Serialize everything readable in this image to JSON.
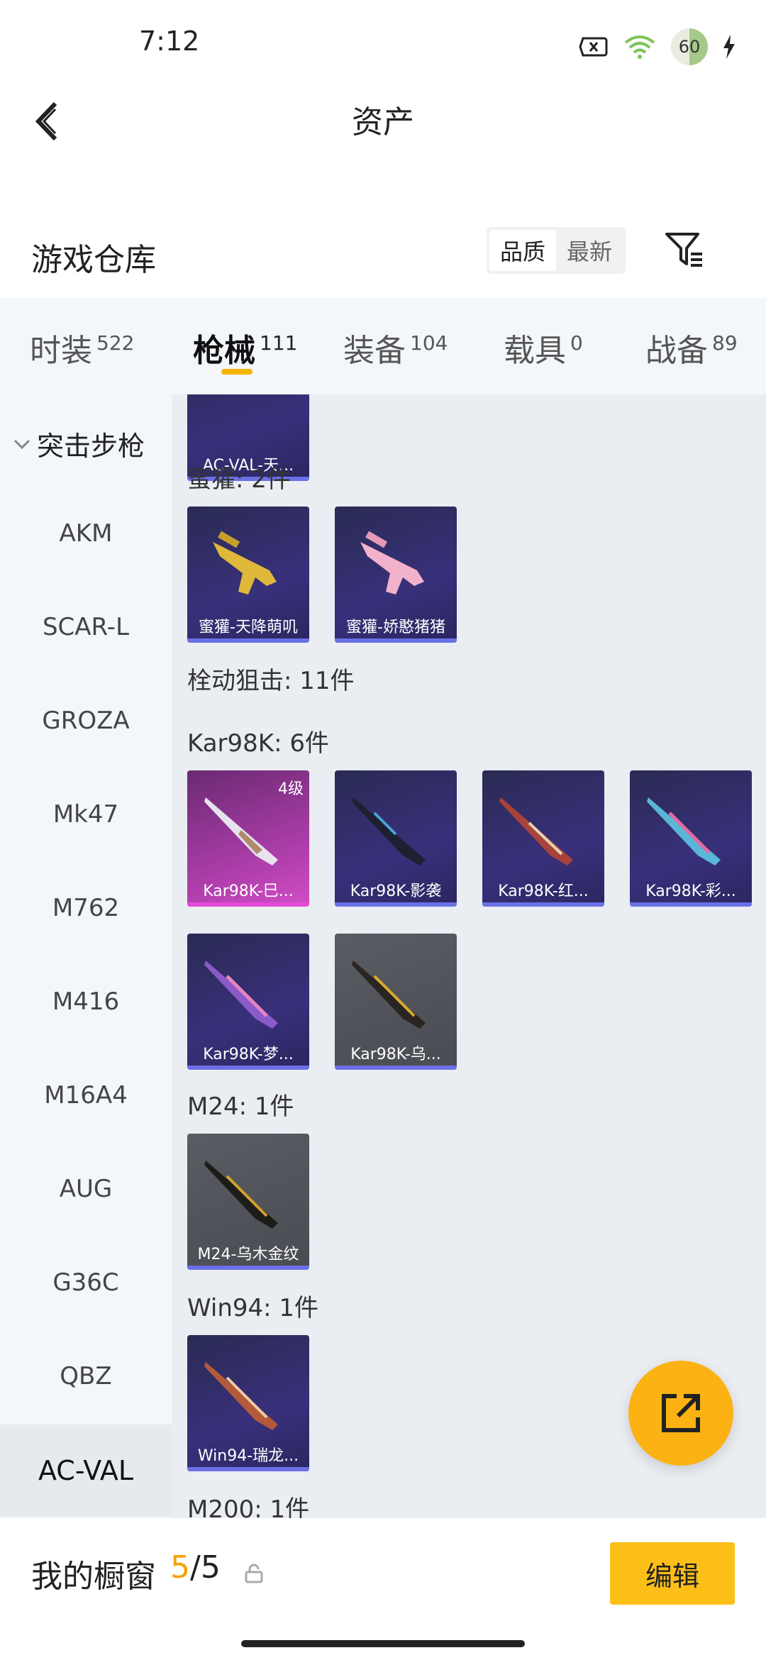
{
  "status": {
    "time": "7:12",
    "battery": "60"
  },
  "header": {
    "title": "资产"
  },
  "section": {
    "title": "游戏仓库",
    "sort_options": [
      "品质",
      "最新"
    ]
  },
  "tabs": [
    {
      "label": "时装",
      "count": "522"
    },
    {
      "label": "枪械",
      "count": "111"
    },
    {
      "label": "装备",
      "count": "104"
    },
    {
      "label": "载具",
      "count": "0"
    },
    {
      "label": "战备",
      "count": "89"
    }
  ],
  "sidebar": {
    "group": "突击步枪",
    "items": [
      "AKM",
      "SCAR-L",
      "GROZA",
      "Mk47",
      "M762",
      "M416",
      "M16A4",
      "AUG",
      "G36C",
      "QBZ",
      "AC-VAL"
    ]
  },
  "content": {
    "top_card": "AC-VAL-天...",
    "groups": [
      {
        "label": "蜜獾: 2件",
        "cards": [
          "蜜獾-天降萌叽",
          "蜜獾-娇憨猪猪"
        ]
      },
      {
        "label": "栓动狙击: 11件"
      },
      {
        "label": "Kar98K: 6件",
        "cards": [
          "Kar98K-巳...",
          "Kar98K-影袭",
          "Kar98K-红...",
          "Kar98K-彩...",
          "Kar98K-梦...",
          "Kar98K-乌..."
        ],
        "level": "4级"
      },
      {
        "label": "M24: 1件",
        "cards": [
          "M24-乌木金纹"
        ]
      },
      {
        "label": "Win94: 1件",
        "cards": [
          "Win94-瑞龙..."
        ]
      },
      {
        "label": "M200: 1件"
      }
    ]
  },
  "bottom": {
    "title": "我的橱窗",
    "count_used": "5",
    "count_sep": "/",
    "count_total": "5",
    "edit_label": "编辑"
  }
}
